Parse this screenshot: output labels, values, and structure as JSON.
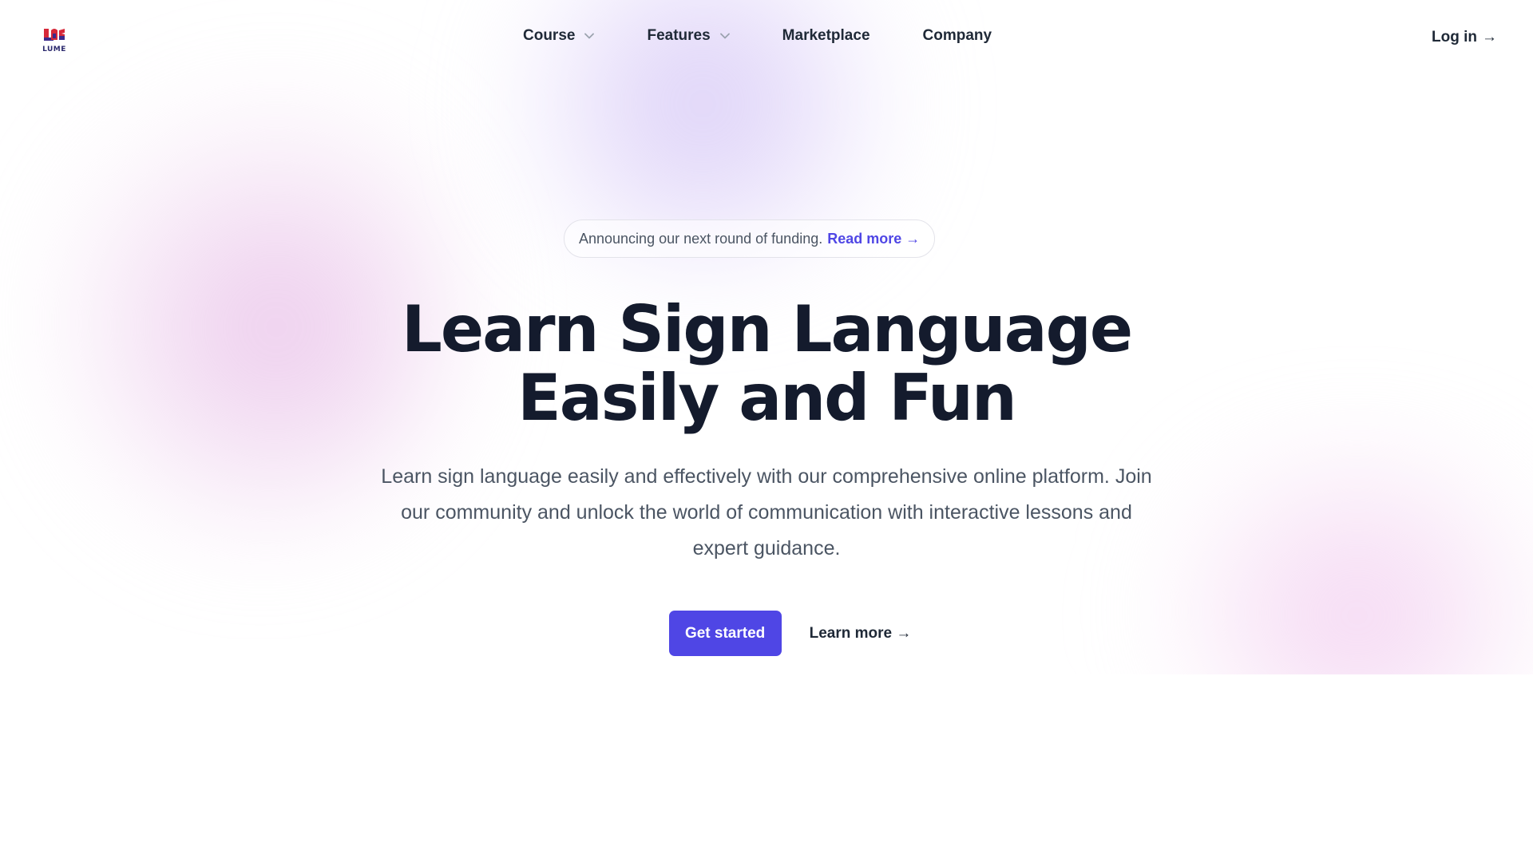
{
  "brand": {
    "logo_text": "LUME",
    "colors": {
      "mark_red": "#d62839",
      "mark_purple": "#3b2a8c"
    }
  },
  "nav": {
    "items": [
      {
        "label": "Course",
        "has_dropdown": true
      },
      {
        "label": "Features",
        "has_dropdown": true
      },
      {
        "label": "Marketplace",
        "has_dropdown": false
      },
      {
        "label": "Company",
        "has_dropdown": false
      }
    ],
    "login_label": "Log in",
    "login_arrow": "→"
  },
  "announcement": {
    "text": "Announcing our next round of funding.",
    "link_label": "Read more →"
  },
  "hero": {
    "headline_line1": "Learn Sign Language",
    "headline_line2": "Easily and Fun",
    "subtitle": "Learn sign language easily and effectively with our comprehensive online platform. Join our community and unlock the world of communication with interactive lessons and expert guidance.",
    "primary_cta": "Get started",
    "secondary_cta": "Learn more →"
  },
  "theme": {
    "accent": "#4f46e5",
    "headline_color": "#141b2d",
    "body_text": "#4b5563"
  }
}
